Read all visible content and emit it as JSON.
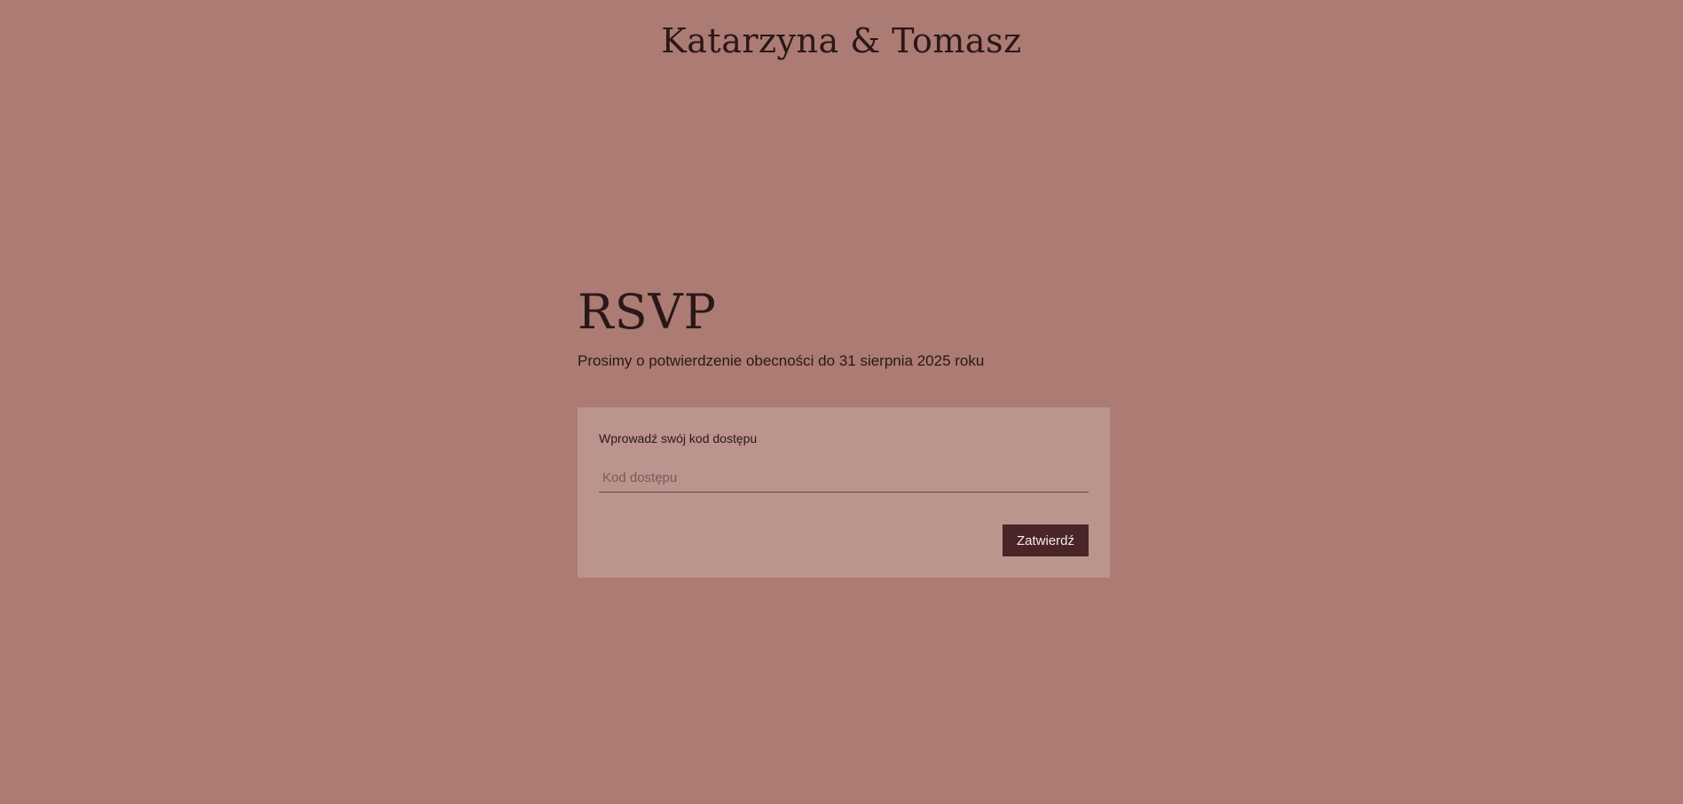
{
  "header": {
    "title": "Katarzyna & Tomasz"
  },
  "rsvp": {
    "heading": "RSVP",
    "subtitle": "Prosimy o potwierdzenie obecności do 31 sierpnia 2025 roku"
  },
  "form": {
    "label": "Wprowadź swój kod dostępu",
    "code_placeholder": "Kod dostępu",
    "code_value": "",
    "submit_label": "Zatwierdź"
  },
  "colors": {
    "background": "#ab7b74",
    "card": "#bb948e",
    "button": "#4a2527",
    "text": "#2b1718"
  }
}
